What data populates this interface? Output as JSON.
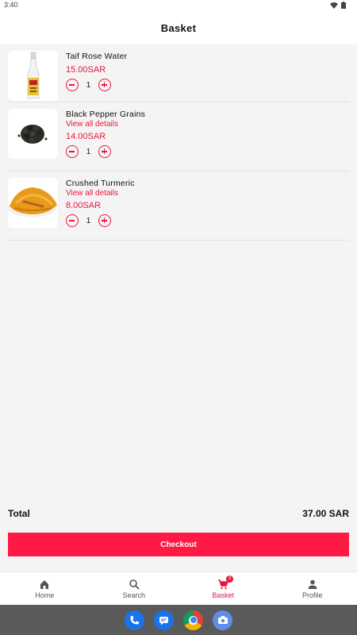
{
  "status_bar": {
    "time": "3:40"
  },
  "header": {
    "title": "Basket"
  },
  "basket": {
    "items": [
      {
        "name": "Taif Rose Water",
        "details_link": "",
        "price": "15.00SAR",
        "quantity": "1"
      },
      {
        "name": "Black Pepper Grains",
        "details_link": "View all details",
        "price": "14.00SAR",
        "quantity": "1"
      },
      {
        "name": "Crushed Turmeric",
        "details_link": "View all details",
        "price": "8.00SAR",
        "quantity": "1"
      }
    ]
  },
  "summary": {
    "total_label": "Total",
    "total_value": "37.00 SAR"
  },
  "checkout": {
    "label": "Checkout"
  },
  "bottom_nav": {
    "items": [
      {
        "label": "Home",
        "icon": "home-icon"
      },
      {
        "label": "Search",
        "icon": "search-icon"
      },
      {
        "label": "Basket",
        "icon": "cart-icon",
        "badge": "3",
        "active": true
      },
      {
        "label": "Profile",
        "icon": "person-icon"
      }
    ]
  },
  "system_dock": {
    "apps": [
      "phone-icon",
      "messages-icon",
      "chrome-icon",
      "camera-icon"
    ]
  },
  "colors": {
    "accent": "#e8173f",
    "checkout": "#ff1a45",
    "background": "#f4f4f4"
  }
}
